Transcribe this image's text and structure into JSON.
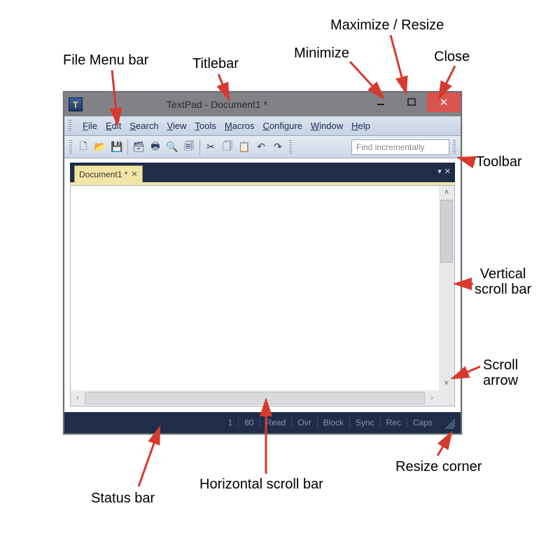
{
  "annotations": {
    "file_menu_bar": "File Menu bar",
    "titlebar": "Titlebar",
    "minimize": "Minimize",
    "maximize": "Maximize / Resize",
    "close": "Close",
    "toolbar": "Toolbar",
    "vscroll": "Vertical\nscroll bar",
    "scroll_arrow": "Scroll\narrow",
    "resize_corner": "Resize corner",
    "hscroll": "Horizontal scroll bar",
    "statusbar": "Status bar"
  },
  "title": "TextPad - Document1 *",
  "menus": [
    "File",
    "Edit",
    "Search",
    "View",
    "Tools",
    "Macros",
    "Configure",
    "Window",
    "Help"
  ],
  "toolbar_icons": [
    "new-file-icon",
    "open-file-icon",
    "save-icon",
    "save-all-icon",
    "print-icon",
    "print-preview-icon",
    "find-icon",
    "cut-icon",
    "copy-icon",
    "paste-icon",
    "undo-icon",
    "redo-icon"
  ],
  "find_placeholder": "Find incrementally",
  "doc_tab": "Document1 *",
  "status": {
    "line": "1",
    "col": "80",
    "read": "Read",
    "ovr": "Ovr",
    "block": "Block",
    "sync": "Sync",
    "rec": "Rec",
    "caps": "Caps"
  }
}
